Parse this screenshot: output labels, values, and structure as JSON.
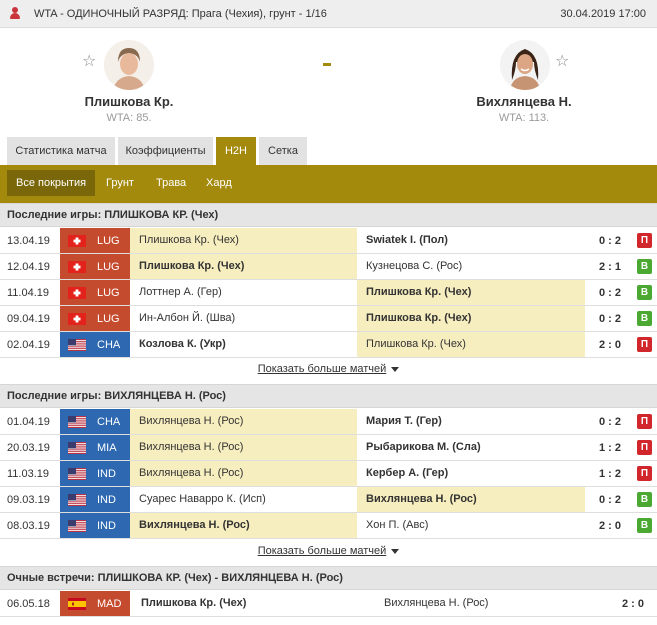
{
  "topbar": {
    "title": "WTA - ОДИНОЧНЫЙ РАЗРЯД: Прага (Чехия), грунт - 1/16",
    "datetime": "30.04.2019 17:00"
  },
  "match": {
    "home": {
      "name": "Плишкова Кр.",
      "rank": "WTA: 85."
    },
    "away": {
      "name": "Вихлянцева Н.",
      "rank": "WTA: 113."
    }
  },
  "tabs": [
    "Статистика матча",
    "Коэффициенты",
    "H2H",
    "Сетка"
  ],
  "active_tab": "H2H",
  "surfaces": [
    "Все покрытия",
    "Грунт",
    "Трава",
    "Хард"
  ],
  "active_surface": "Все покрытия",
  "sections": [
    {
      "title": "Последние игры: ПЛИШКОВА КР. (Чех)",
      "rows": [
        {
          "date": "13.04.19",
          "flag": "switzerland",
          "code": "LUG",
          "home": "Плишкова Кр. (Чех)",
          "away": "Swiatek I. (Пол)",
          "score": "0 : 2",
          "result": "П"
        },
        {
          "date": "12.04.19",
          "flag": "switzerland",
          "code": "LUG",
          "home": "Плишкова Кр. (Чех)",
          "away": "Кузнецова С. (Рос)",
          "score": "2 : 1",
          "result": "В"
        },
        {
          "date": "11.04.19",
          "flag": "switzerland",
          "code": "LUG",
          "home": "Лоттнер А. (Гер)",
          "away": "Плишкова Кр. (Чех)",
          "score": "0 : 2",
          "result": "В"
        },
        {
          "date": "09.04.19",
          "flag": "switzerland",
          "code": "LUG",
          "home": "Ин-Албон Й. (Шва)",
          "away": "Плишкова Кр. (Чех)",
          "score": "0 : 2",
          "result": "В"
        },
        {
          "date": "02.04.19",
          "flag": "usa",
          "code": "CHA",
          "home": "Козлова К. (Укр)",
          "away": "Плишкова Кр. (Чех)",
          "score": "2 : 0",
          "result": "П"
        }
      ],
      "show_more": "Показать больше матчей"
    },
    {
      "title": "Последние игры: ВИХЛЯНЦЕВА Н. (Рос)",
      "rows": [
        {
          "date": "01.04.19",
          "flag": "usa",
          "code": "CHA",
          "home": "Вихлянцева Н. (Рос)",
          "away": "Мария Т. (Гер)",
          "score": "0 : 2",
          "result": "П"
        },
        {
          "date": "20.03.19",
          "flag": "usa",
          "code": "MIA",
          "home": "Вихлянцева Н. (Рос)",
          "away": "Рыбарикова М. (Сла)",
          "score": "1 : 2",
          "result": "П"
        },
        {
          "date": "11.03.19",
          "flag": "usa",
          "code": "IND",
          "home": "Вихлянцева Н. (Рос)",
          "away": "Кербер А. (Гер)",
          "score": "1 : 2",
          "result": "П"
        },
        {
          "date": "09.03.19",
          "flag": "usa",
          "code": "IND",
          "home": "Суарес Наварро К. (Исп)",
          "away": "Вихлянцева Н. (Рос)",
          "score": "0 : 2",
          "result": "В"
        },
        {
          "date": "08.03.19",
          "flag": "usa",
          "code": "IND",
          "home": "Вихлянцева Н. (Рос)",
          "away": "Хон П. (Авс)",
          "score": "2 : 0",
          "result": "В"
        }
      ],
      "show_more": "Показать больше матчей"
    }
  ],
  "h2h": {
    "title": "Очные встречи: ПЛИШКОВА КР. (Чех) - ВИХЛЯНЦЕВА Н. (Рос)",
    "rows": [
      {
        "date": "06.05.18",
        "flag": "spain",
        "code": "MAD",
        "home": "Плишкова Кр. (Чех)",
        "away": "Вихлянцева Н. (Рос)",
        "score": "2 : 0"
      }
    ]
  },
  "colors": {
    "accent": "#a38a0d",
    "win_bg": "#f7eebf",
    "loss": "#d1262b",
    "win": "#4ba931",
    "tourney_red": "#c54b2e",
    "tourney_blue": "#2d68b1"
  }
}
